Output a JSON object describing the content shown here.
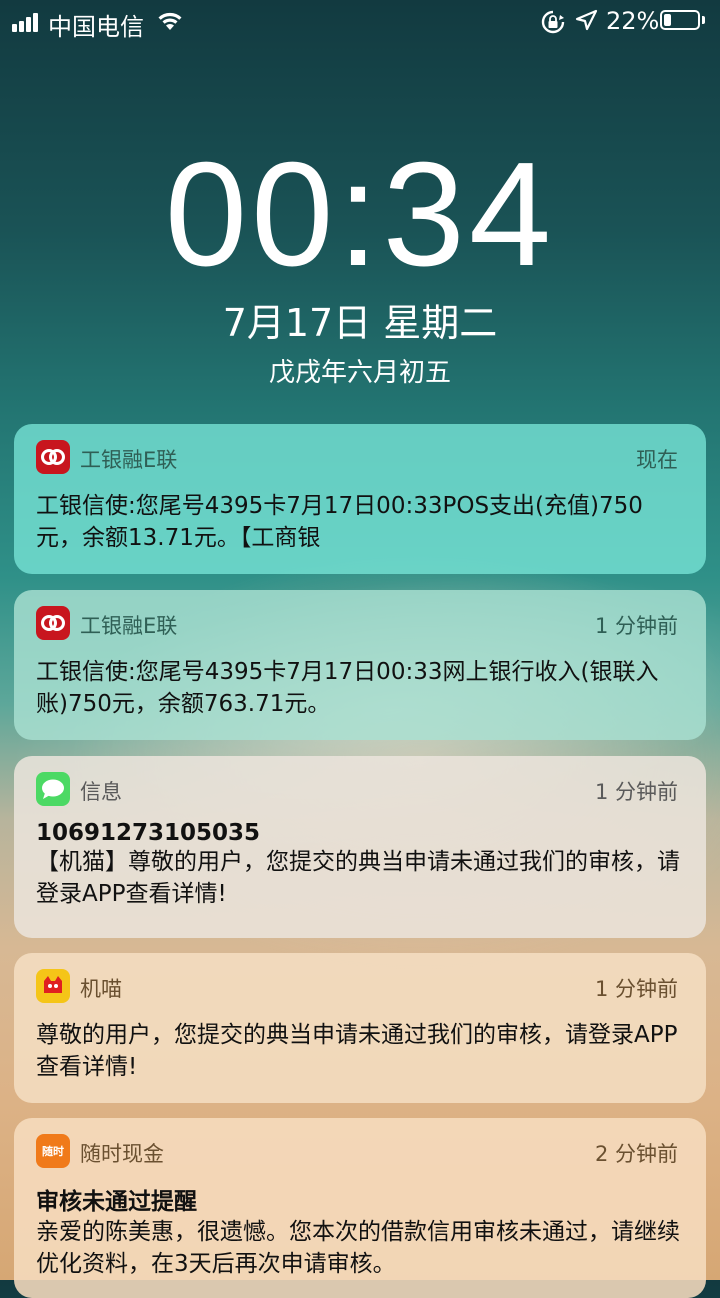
{
  "status_bar": {
    "carrier": "中国电信",
    "battery_percent": "22%",
    "battery_level": 0.22,
    "icons": [
      "signal-icon",
      "wifi-icon",
      "rotation-lock-icon",
      "location-icon",
      "battery-icon"
    ]
  },
  "lockscreen": {
    "time": "00:34",
    "date": "7月17日 星期二",
    "lunar_date": "戊戌年六月初五"
  },
  "notifications": [
    {
      "app": "工银融E联",
      "time": "现在",
      "icon": "icbc-icon",
      "body": "工银信使:您尾号4395卡7月17日00:33POS支出(充值)750元，余额13.71元。【工商银"
    },
    {
      "app": "工银融E联",
      "time": "1 分钟前",
      "icon": "icbc-icon",
      "body": "工银信使:您尾号4395卡7月17日00:33网上银行收入(银联入账)750元，余额763.71元。"
    },
    {
      "app": "信息",
      "time": "1 分钟前",
      "icon": "messages-icon",
      "title": "10691273105035",
      "body": "【机猫】尊敬的用户，您提交的典当申请未通过我们的审核，请登录APP查看详情!"
    },
    {
      "app": "机喵",
      "time": "1 分钟前",
      "icon": "jimiao-icon",
      "body": "尊敬的用户，您提交的典当申请未通过我们的审核，请登录APP查看详情!"
    },
    {
      "app": "随时现金",
      "time": "2 分钟前",
      "icon": "suishi-cash-icon",
      "icon_text": "随时",
      "title": "审核未通过提醒",
      "body": "亲爱的陈美惠，很遗憾。您本次的借款信用审核未通过，请继续优化资料，在3天后再次申请审核。"
    }
  ]
}
